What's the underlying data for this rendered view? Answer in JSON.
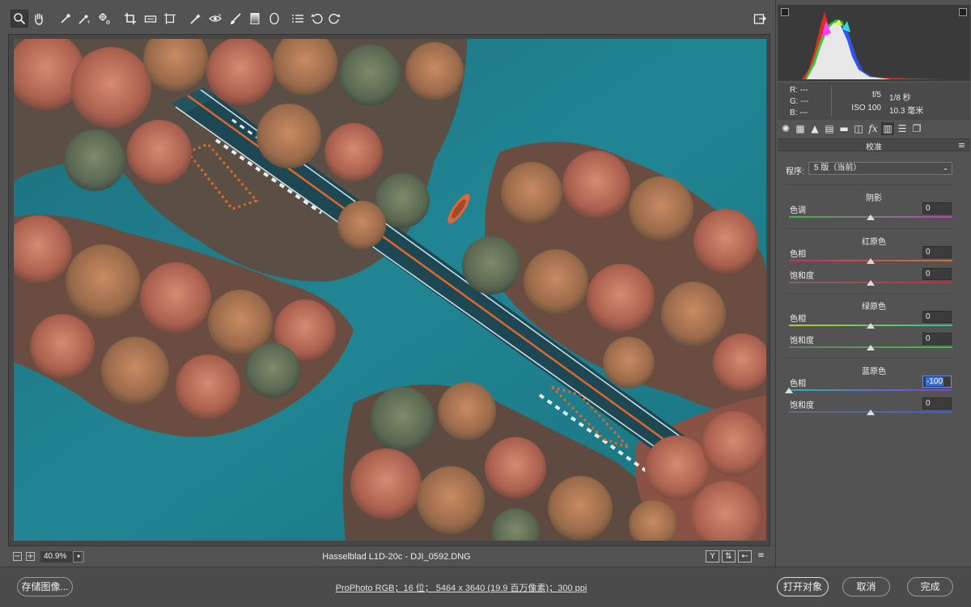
{
  "toolbar": {
    "tools": [
      {
        "name": "zoom-tool",
        "icon": "magnifier-icon",
        "active": true
      },
      {
        "name": "hand-tool",
        "icon": "hand-icon"
      },
      {
        "name": "white-balance-tool",
        "icon": "eyedropper-icon"
      },
      {
        "name": "color-sampler-tool",
        "icon": "color-sampler-icon"
      },
      {
        "name": "target-adjustment-tool",
        "icon": "target-adjust-icon"
      },
      {
        "name": "crop-tool",
        "icon": "crop-icon"
      },
      {
        "name": "straighten-tool",
        "icon": "level-icon"
      },
      {
        "name": "transform-tool",
        "icon": "transform-icon"
      },
      {
        "name": "spot-removal-tool",
        "icon": "healing-brush-icon"
      },
      {
        "name": "red-eye-tool",
        "icon": "red-eye-icon"
      },
      {
        "name": "adjustment-brush-tool",
        "icon": "brush-icon"
      },
      {
        "name": "graduated-filter-tool",
        "icon": "graduated-filter-icon"
      },
      {
        "name": "radial-filter-tool",
        "icon": "radial-filter-icon"
      },
      {
        "name": "preferences-tool",
        "icon": "list-icon"
      },
      {
        "name": "rotate-ccw-tool",
        "icon": "rotate-ccw-icon"
      },
      {
        "name": "rotate-cw-tool",
        "icon": "rotate-cw-icon"
      }
    ],
    "fullscreen_icon": "export-icon"
  },
  "status_bar": {
    "zoom": "40.9%",
    "filename": "Hasselblad L1D-20c -  DJI_0592.DNG",
    "right_buttons": [
      "Y",
      "⇅",
      "←",
      "≡"
    ]
  },
  "bottom": {
    "save_label": "存储图像...",
    "workflow": "ProPhoto RGB；16 位；  5464 x 3640 (19.9 百万像素)；300 ppi",
    "open_label": "打开对象",
    "cancel_label": "取消",
    "done_label": "完成"
  },
  "readout": {
    "r": "R:   ---",
    "g": "G:   ---",
    "b": "B:   ---",
    "aperture": "f/5",
    "shutter": "1/8 秒",
    "iso": "ISO 100",
    "focal": "10.3 毫米"
  },
  "panel": {
    "title": "校准",
    "process_label": "程序:",
    "process_value": "5 版（当前）",
    "sections": [
      {
        "title": "阴影",
        "sliders": [
          {
            "label": "色调",
            "value": "0",
            "pos": 0.5,
            "gradient": [
              "#3fb83f",
              "#c03ac0"
            ]
          }
        ]
      },
      {
        "title": "红原色",
        "sliders": [
          {
            "label": "色相",
            "value": "0",
            "pos": 0.5,
            "gradient": [
              "#c0306a",
              "#e06a2a"
            ]
          },
          {
            "label": "饱和度",
            "value": "0",
            "pos": 0.5,
            "gradient": [
              "#7a6a6a",
              "#d02a3a"
            ]
          }
        ]
      },
      {
        "title": "绿原色",
        "sliders": [
          {
            "label": "色相",
            "value": "0",
            "pos": 0.5,
            "gradient": [
              "#b8c830",
              "#30c0a0"
            ]
          },
          {
            "label": "饱和度",
            "value": "0",
            "pos": 0.5,
            "gradient": [
              "#6a7a6a",
              "#40c040"
            ]
          }
        ]
      },
      {
        "title": "蓝原色",
        "sliders": [
          {
            "label": "色相",
            "value": "-100",
            "pos": 0.0,
            "gradient": [
              "#30a8c8",
              "#8040c8"
            ],
            "selected": true
          },
          {
            "label": "饱和度",
            "value": "0",
            "pos": 0.5,
            "gradient": [
              "#6a6a7a",
              "#3a60d8"
            ]
          }
        ]
      }
    ]
  },
  "colors": {
    "accent": "#3f6fce",
    "water": "#1f7a86",
    "foliage": "#b86a55",
    "road": "#1d4752",
    "stripe": "#e0682a"
  }
}
